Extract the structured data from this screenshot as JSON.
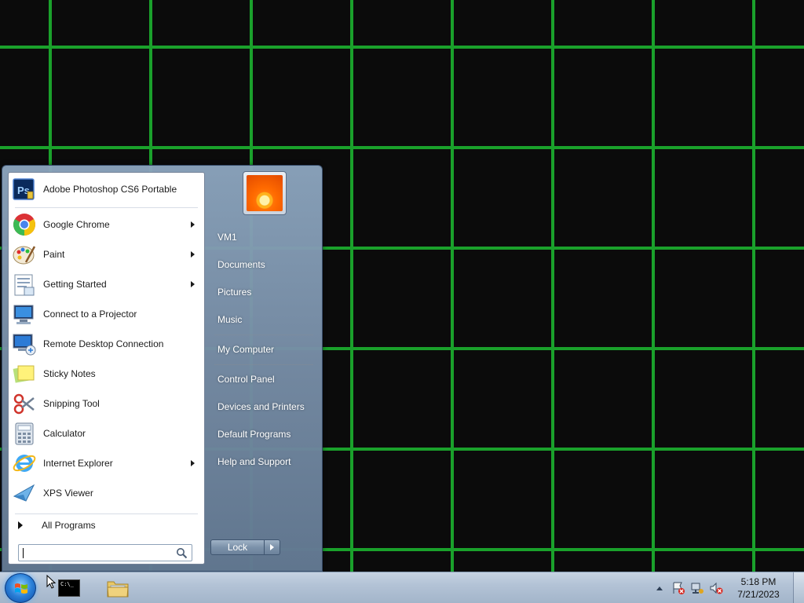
{
  "start_menu": {
    "programs": [
      {
        "label": "Adobe Photoshop CS6 Portable",
        "icon": "photoshop-icon",
        "has_submenu": false
      },
      {
        "label": "Google Chrome",
        "icon": "chrome-icon",
        "has_submenu": true
      },
      {
        "label": "Paint",
        "icon": "paint-icon",
        "has_submenu": true
      },
      {
        "label": "Getting Started",
        "icon": "getting-started-icon",
        "has_submenu": true
      },
      {
        "label": "Connect to a Projector",
        "icon": "projector-icon",
        "has_submenu": false
      },
      {
        "label": "Remote Desktop Connection",
        "icon": "remote-desktop-icon",
        "has_submenu": false
      },
      {
        "label": "Sticky Notes",
        "icon": "sticky-notes-icon",
        "has_submenu": false
      },
      {
        "label": "Snipping Tool",
        "icon": "snipping-tool-icon",
        "has_submenu": false
      },
      {
        "label": "Calculator",
        "icon": "calculator-icon",
        "has_submenu": false
      },
      {
        "label": "Internet Explorer",
        "icon": "internet-explorer-icon",
        "has_submenu": true
      },
      {
        "label": "XPS Viewer",
        "icon": "xps-viewer-icon",
        "has_submenu": false
      }
    ],
    "all_programs": "All Programs",
    "search": {
      "value": "",
      "placeholder": ""
    },
    "right_items": [
      {
        "label": "VM1"
      },
      {
        "label": "Documents"
      },
      {
        "label": "Pictures"
      },
      {
        "label": "Music"
      },
      {
        "label": "My Computer"
      },
      {
        "label": "Control Panel"
      },
      {
        "label": "Devices and Printers"
      },
      {
        "label": "Default Programs"
      },
      {
        "label": "Help and Support"
      }
    ],
    "lock_label": "Lock"
  },
  "taskbar": {
    "clock_time": "5:18 PM",
    "clock_date": "7/21/2023",
    "cmd_text": "C:\\_"
  },
  "colors": {
    "wallpaper_blue": "#1f6fe0",
    "frame_orange": "#ff7a12",
    "window_green": "#1aa12b"
  }
}
